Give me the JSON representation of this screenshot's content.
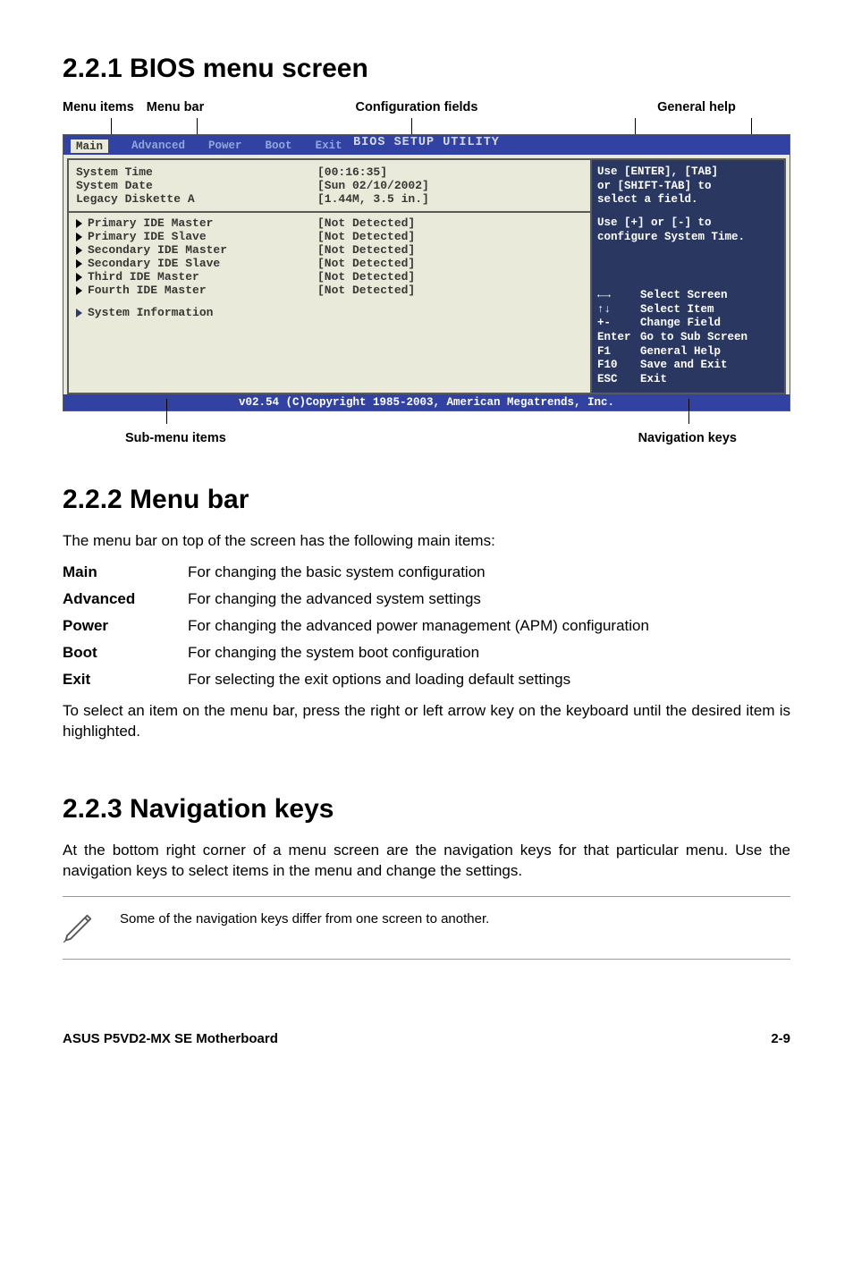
{
  "section1": {
    "heading": "2.2.1   BIOS menu screen",
    "labels": {
      "menu_items": "Menu items",
      "menu_bar": "Menu bar",
      "config_fields": "Configuration fields",
      "general_help": "General help",
      "sub_menu": "Sub-menu items",
      "nav_keys": "Navigation keys"
    }
  },
  "bios": {
    "title": "BIOS SETUP UTILITY",
    "tabs": [
      "Main",
      "Advanced",
      "Power",
      "Boot",
      "Exit"
    ],
    "rows_top": [
      {
        "label": "System Time",
        "value": "[00:16:35]"
      },
      {
        "label": "System Date",
        "value": "[Sun 02/10/2002]"
      },
      {
        "label": "Legacy Diskette A",
        "value": "[1.44M, 3.5 in.]"
      }
    ],
    "rows_mid": [
      {
        "label": "Primary IDE Master",
        "value": "[Not Detected]"
      },
      {
        "label": "Primary IDE Slave",
        "value": "[Not Detected]"
      },
      {
        "label": "Secondary IDE Master",
        "value": "[Not Detected]"
      },
      {
        "label": "Secondary IDE Slave",
        "value": "[Not Detected]"
      },
      {
        "label": "Third IDE Master",
        "value": "[Not Detected]"
      },
      {
        "label": "Fourth IDE Master",
        "value": "[Not Detected]"
      }
    ],
    "rows_last": [
      {
        "label": "System Information",
        "value": ""
      }
    ],
    "help_top1": "Use [ENTER], [TAB]",
    "help_top2": "or [SHIFT-TAB] to",
    "help_top3": "select a field.",
    "help_mid1": "Use [+] or [-] to",
    "help_mid2": "configure System Time.",
    "keys": [
      {
        "k": "←→",
        "d": "Select Screen"
      },
      {
        "k": "↑↓",
        "d": "Select Item"
      },
      {
        "k": "+-",
        "d": "Change Field"
      },
      {
        "k": "Enter",
        "d": "Go to Sub Screen"
      },
      {
        "k": "F1",
        "d": "General Help"
      },
      {
        "k": "F10",
        "d": "Save and Exit"
      },
      {
        "k": "ESC",
        "d": "Exit"
      }
    ],
    "footer": "v02.54 (C)Copyright 1985-2003, American Megatrends, Inc."
  },
  "section2": {
    "heading": "2.2.2   Menu bar",
    "intro": "The menu bar on top of the screen has the following main items:",
    "defs": [
      {
        "term": "Main",
        "desc": "For changing the basic system configuration"
      },
      {
        "term": "Advanced",
        "desc": "For changing the advanced system settings"
      },
      {
        "term": "Power",
        "desc": "For changing the advanced power management (APM) configuration"
      },
      {
        "term": "Boot",
        "desc": "For changing the system boot configuration"
      },
      {
        "term": "Exit",
        "desc": "For selecting the exit options and loading default settings"
      }
    ],
    "outro": "To select an item on the menu bar, press the right or left arrow key on the keyboard until the desired item is highlighted."
  },
  "section3": {
    "heading": "2.2.3   Navigation keys",
    "body": "At the bottom right corner of a menu screen are the navigation keys for that particular menu. Use the navigation keys to select items in the menu and change the settings.",
    "note": "Some of the navigation keys differ from one screen to another."
  },
  "footer": {
    "left": "ASUS P5VD2-MX SE Motherboard",
    "right": "2-9"
  }
}
